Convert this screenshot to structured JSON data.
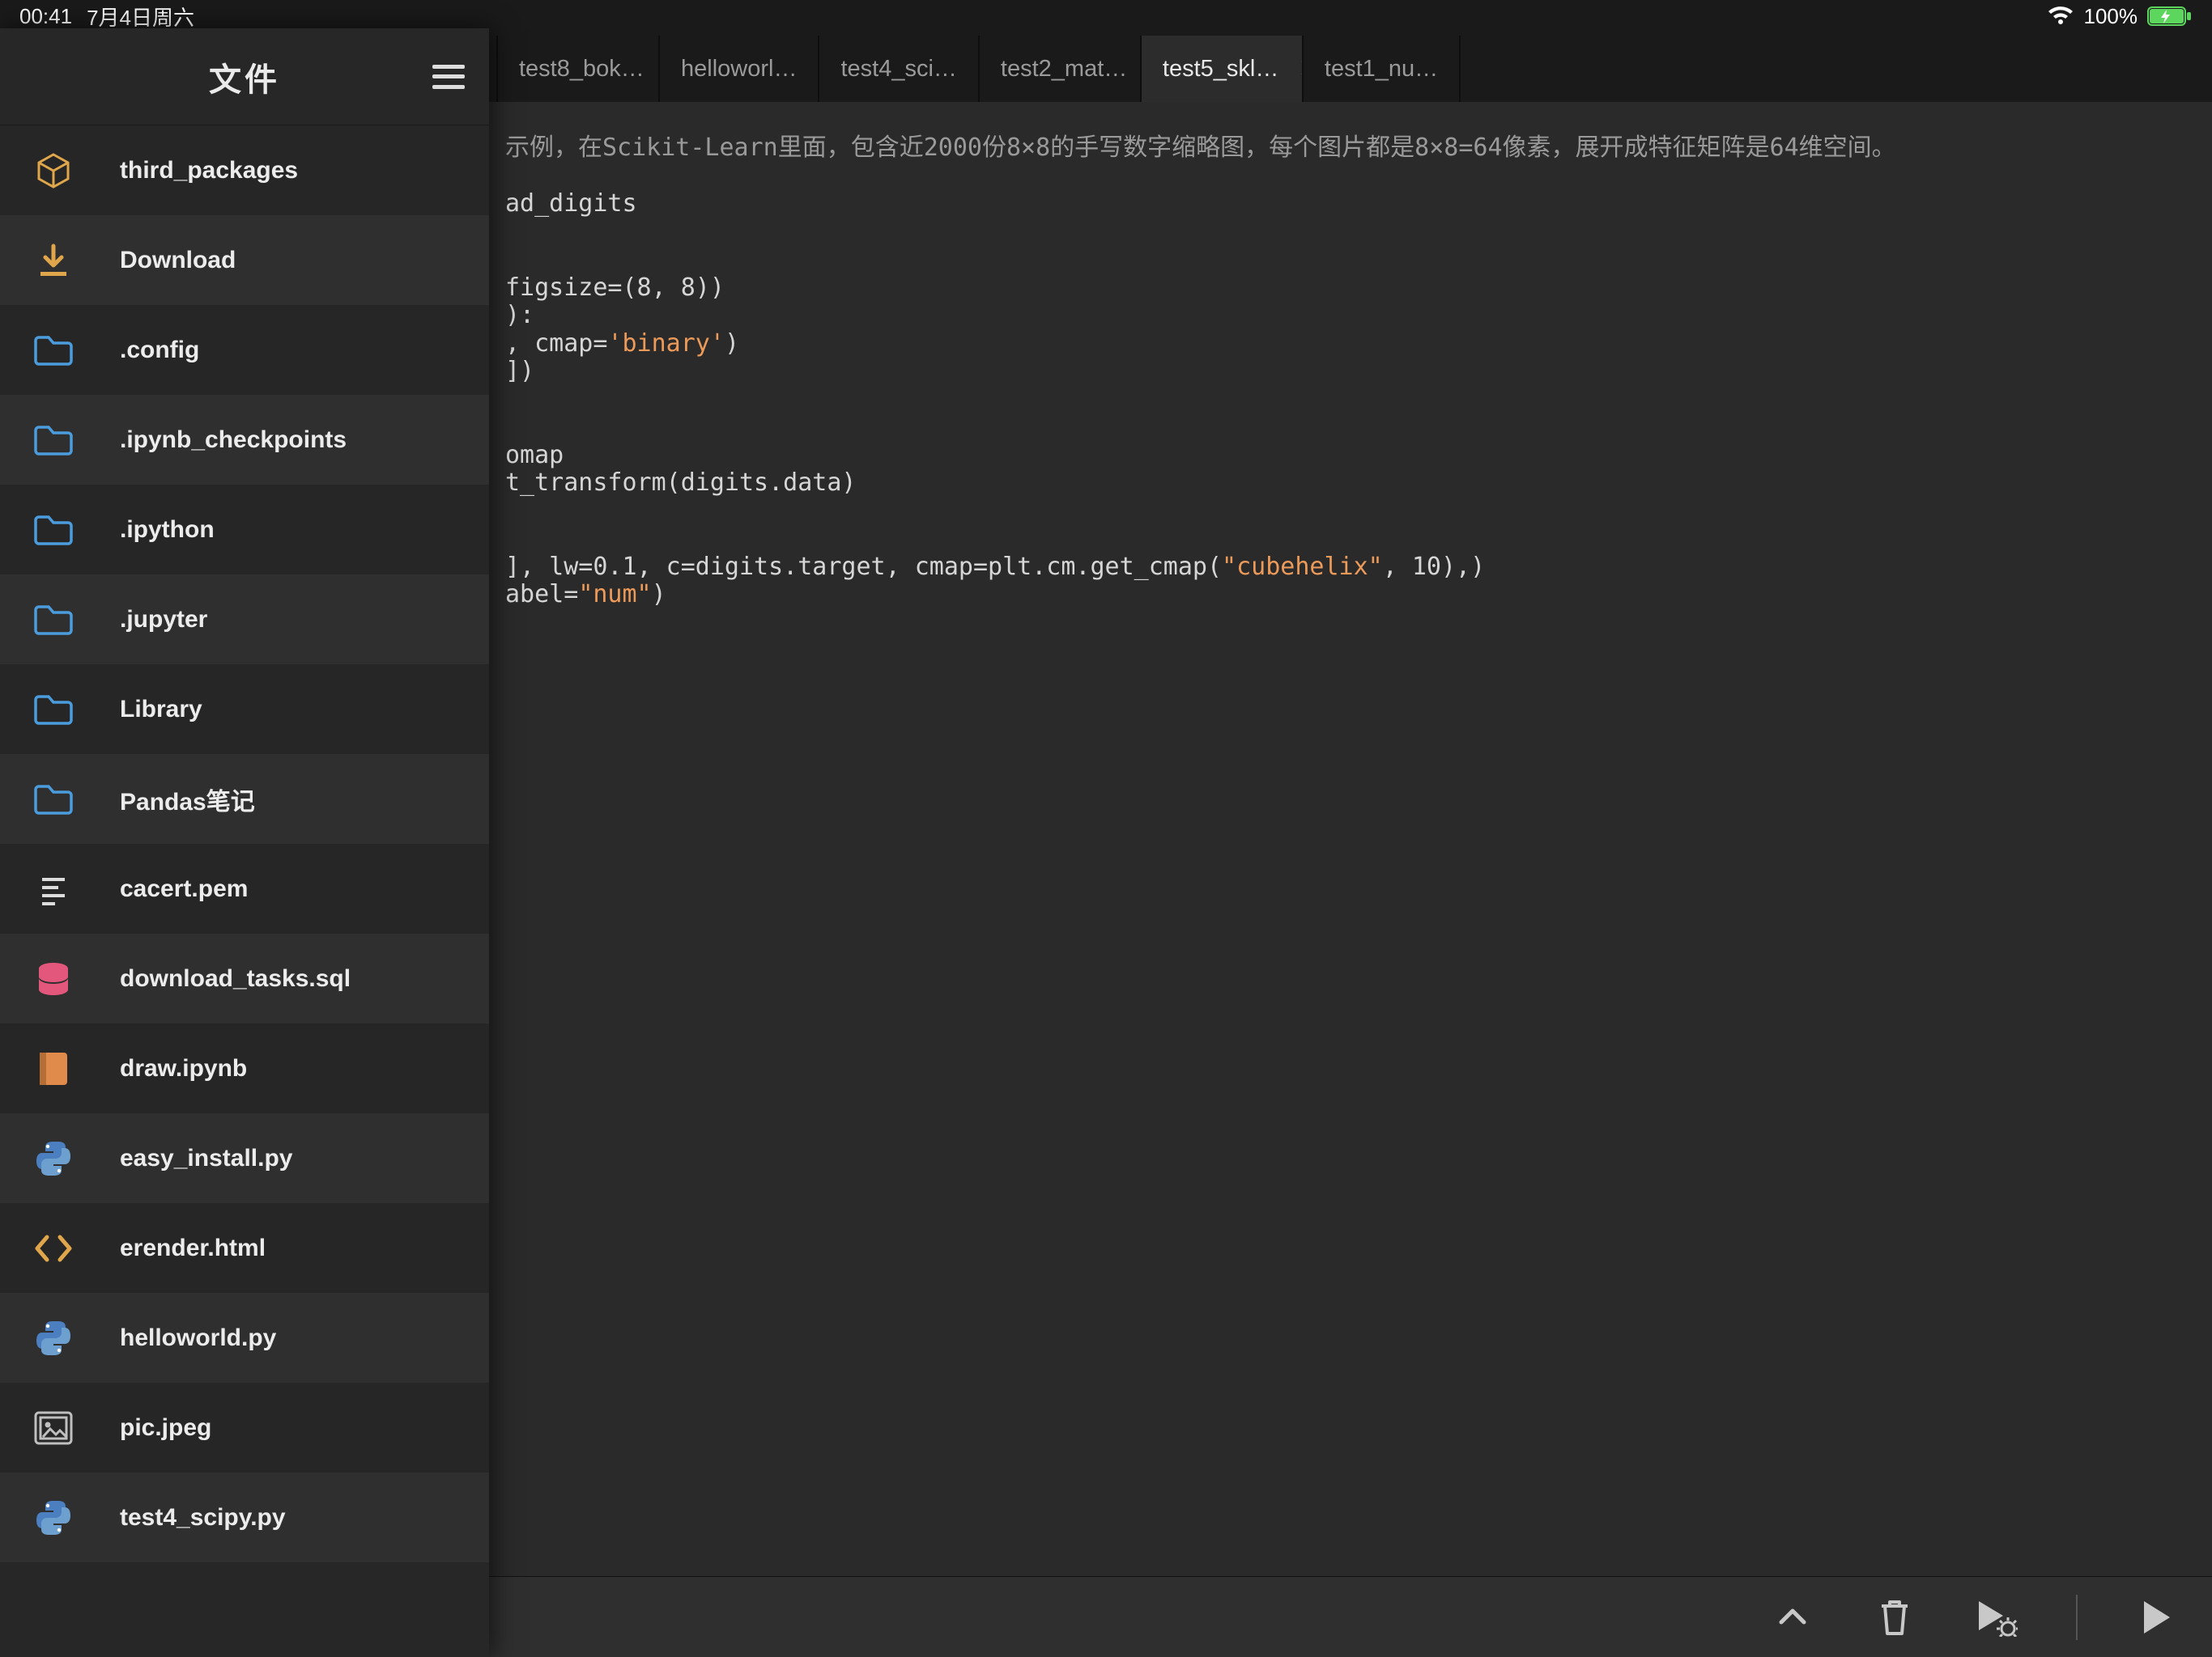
{
  "status_bar": {
    "time": "00:41",
    "date": "7月4日周六",
    "battery_pct": "100%"
  },
  "sidebar": {
    "title": "文件",
    "items": [
      {
        "label": "third_packages",
        "icon": "package"
      },
      {
        "label": "Download",
        "icon": "download"
      },
      {
        "label": ".config",
        "icon": "folder"
      },
      {
        "label": ".ipynb_checkpoints",
        "icon": "folder"
      },
      {
        "label": ".ipython",
        "icon": "folder"
      },
      {
        "label": ".jupyter",
        "icon": "folder"
      },
      {
        "label": "Library",
        "icon": "folder"
      },
      {
        "label": "Pandas笔记",
        "icon": "folder"
      },
      {
        "label": "cacert.pem",
        "icon": "text"
      },
      {
        "label": "download_tasks.sql",
        "icon": "db"
      },
      {
        "label": "draw.ipynb",
        "icon": "notebook"
      },
      {
        "label": "easy_install.py",
        "icon": "python"
      },
      {
        "label": "erender.html",
        "icon": "html"
      },
      {
        "label": "helloworld.py",
        "icon": "python"
      },
      {
        "label": "pic.jpeg",
        "icon": "image"
      },
      {
        "label": "test4_scipy.py",
        "icon": "python"
      }
    ]
  },
  "tabs": {
    "items": [
      {
        "label": "test8_bok…",
        "active": false
      },
      {
        "label": "helloworl…",
        "active": false
      },
      {
        "label": "test4_sci…",
        "active": false
      },
      {
        "label": "test2_mat…",
        "active": false
      },
      {
        "label": "test5_skl…",
        "active": true
      },
      {
        "label": "test1_nu…",
        "active": false
      }
    ]
  },
  "editor": {
    "lines": [
      {
        "segs": [
          {
            "cls": "tok-comm",
            "t": "示例，在Scikit-Learn里面，包含近2000份8×8的手写数字缩略图，每个图片都是8×8=64像素，展开成特征矩阵是64维空间。"
          }
        ]
      },
      {
        "segs": []
      },
      {
        "segs": [
          {
            "t": "ad_digits"
          }
        ]
      },
      {
        "segs": []
      },
      {
        "segs": []
      },
      {
        "segs": [
          {
            "t": "figsize=(8, 8))"
          }
        ]
      },
      {
        "segs": [
          {
            "t": "):"
          }
        ]
      },
      {
        "segs": [
          {
            "t": ", cmap="
          },
          {
            "cls": "tok-str",
            "t": "'binary'"
          },
          {
            "t": ")"
          }
        ]
      },
      {
        "segs": [
          {
            "t": "])"
          }
        ]
      },
      {
        "segs": []
      },
      {
        "segs": []
      },
      {
        "segs": [
          {
            "t": "omap"
          }
        ]
      },
      {
        "segs": [
          {
            "t": "t_transform(digits.data)"
          }
        ]
      },
      {
        "segs": []
      },
      {
        "segs": []
      },
      {
        "segs": [
          {
            "t": "], lw=0.1, c=digits.target, cmap=plt.cm.get_cmap("
          },
          {
            "cls": "tok-str",
            "t": "\"cubehelix\""
          },
          {
            "t": ", 10),)"
          }
        ]
      },
      {
        "segs": [
          {
            "t": "abel="
          },
          {
            "cls": "tok-str",
            "t": "\"num\""
          },
          {
            "t": ")"
          }
        ]
      }
    ]
  },
  "icon_colors": {
    "package": "#e0a64b",
    "download": "#e0a64b",
    "folder": "#4b9cdc",
    "text": "#dcdcdc",
    "db": "#e4577c",
    "notebook": "#e08a4b",
    "python": "#4b7fbf",
    "html": "#e0a64b",
    "image": "#bfbfbf"
  }
}
